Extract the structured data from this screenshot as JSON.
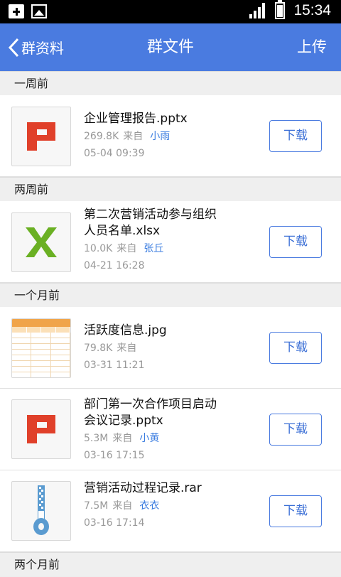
{
  "status_bar": {
    "time": "15:34"
  },
  "nav": {
    "back_label": "群资料",
    "title": "群文件",
    "upload_label": "上传"
  },
  "download_label": "下载",
  "from_label": "来自",
  "sections": [
    {
      "header": "一周前"
    },
    {
      "header": "两周前"
    },
    {
      "header": "一个月前"
    },
    {
      "header": "两个月前"
    }
  ],
  "files": [
    {
      "name": "企业管理报告.pptx",
      "size": "269.8K",
      "uploader": "小雨",
      "date": "05-04 09:39",
      "icon": "pptx-icon"
    },
    {
      "name_line1": "第二次营销活动参与组织",
      "name_line2": "人员名单.xlsx",
      "size": "10.0K",
      "uploader": "张丘",
      "date": "04-21 16:28",
      "icon": "xlsx-icon"
    },
    {
      "name": "活跃度信息.jpg",
      "size": "79.8K",
      "uploader": "",
      "date": "03-31 11:21",
      "icon": "jpg-thumbnail"
    },
    {
      "name_line1": "部门第一次合作项目启动",
      "name_line2": "会议记录.pptx",
      "size": "5.3M",
      "uploader": "小黄",
      "date": "03-16 17:15",
      "icon": "pptx-icon"
    },
    {
      "name": "营销活动过程记录.rar",
      "size": "7.5M",
      "uploader": "衣衣",
      "date": "03-16 17:14",
      "icon": "rar-icon"
    }
  ],
  "colors": {
    "nav_bg": "#4a7be0",
    "link": "#3b7de0",
    "pptx": "#e0402a",
    "xlsx": "#6ab023",
    "rar": "#5a9bd0"
  }
}
